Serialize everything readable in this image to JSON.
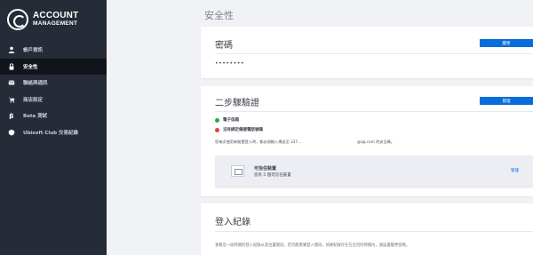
{
  "brand": {
    "line1": "ACCOUNT",
    "line2": "MANAGEMENT"
  },
  "sidebar": {
    "items": [
      {
        "label": "帳戶資訊",
        "icon": "person-icon",
        "active": false
      },
      {
        "label": "安全性",
        "icon": "lock-icon",
        "active": true
      },
      {
        "label": "聯絡與通訊",
        "icon": "mail-icon",
        "active": false
      },
      {
        "label": "商店設定",
        "icon": "cart-icon",
        "active": false
      },
      {
        "label": "Beta 測試",
        "icon": "beta-icon",
        "active": false
      },
      {
        "label": "Ubisoft Club 交易紀錄",
        "icon": "club-icon",
        "active": false
      }
    ]
  },
  "page": {
    "title": "安全性"
  },
  "password_card": {
    "title": "密碼",
    "button": "變更",
    "mask": "••••••••"
  },
  "twofa_card": {
    "title": "二步驟驗證",
    "button": "管理",
    "status_enabled": "電子信箱",
    "status_disabled": "沒有綁定備援電話號碼",
    "description": "您每次使用新裝置登入時，都必須輸入傳送至 337...",
    "email_suffix": "@qq.com 的安全碼。",
    "device_title": "可信任裝置",
    "device_sub": "您有 5 個可信任裝置",
    "device_link": "管理",
    "colors": {
      "enabled": "#2ea44f",
      "disabled": "#e0443e"
    }
  },
  "login_card": {
    "title": "登入紀錄",
    "description": "查看近一段時間的登入紀錄以及位置資訊。若可能需要登入資訊，如果紀錄存在在任何的時間內，請設置變更密碼。"
  },
  "colors": {
    "accent": "#0a6cdb",
    "sidebar_bg": "#262b38"
  }
}
